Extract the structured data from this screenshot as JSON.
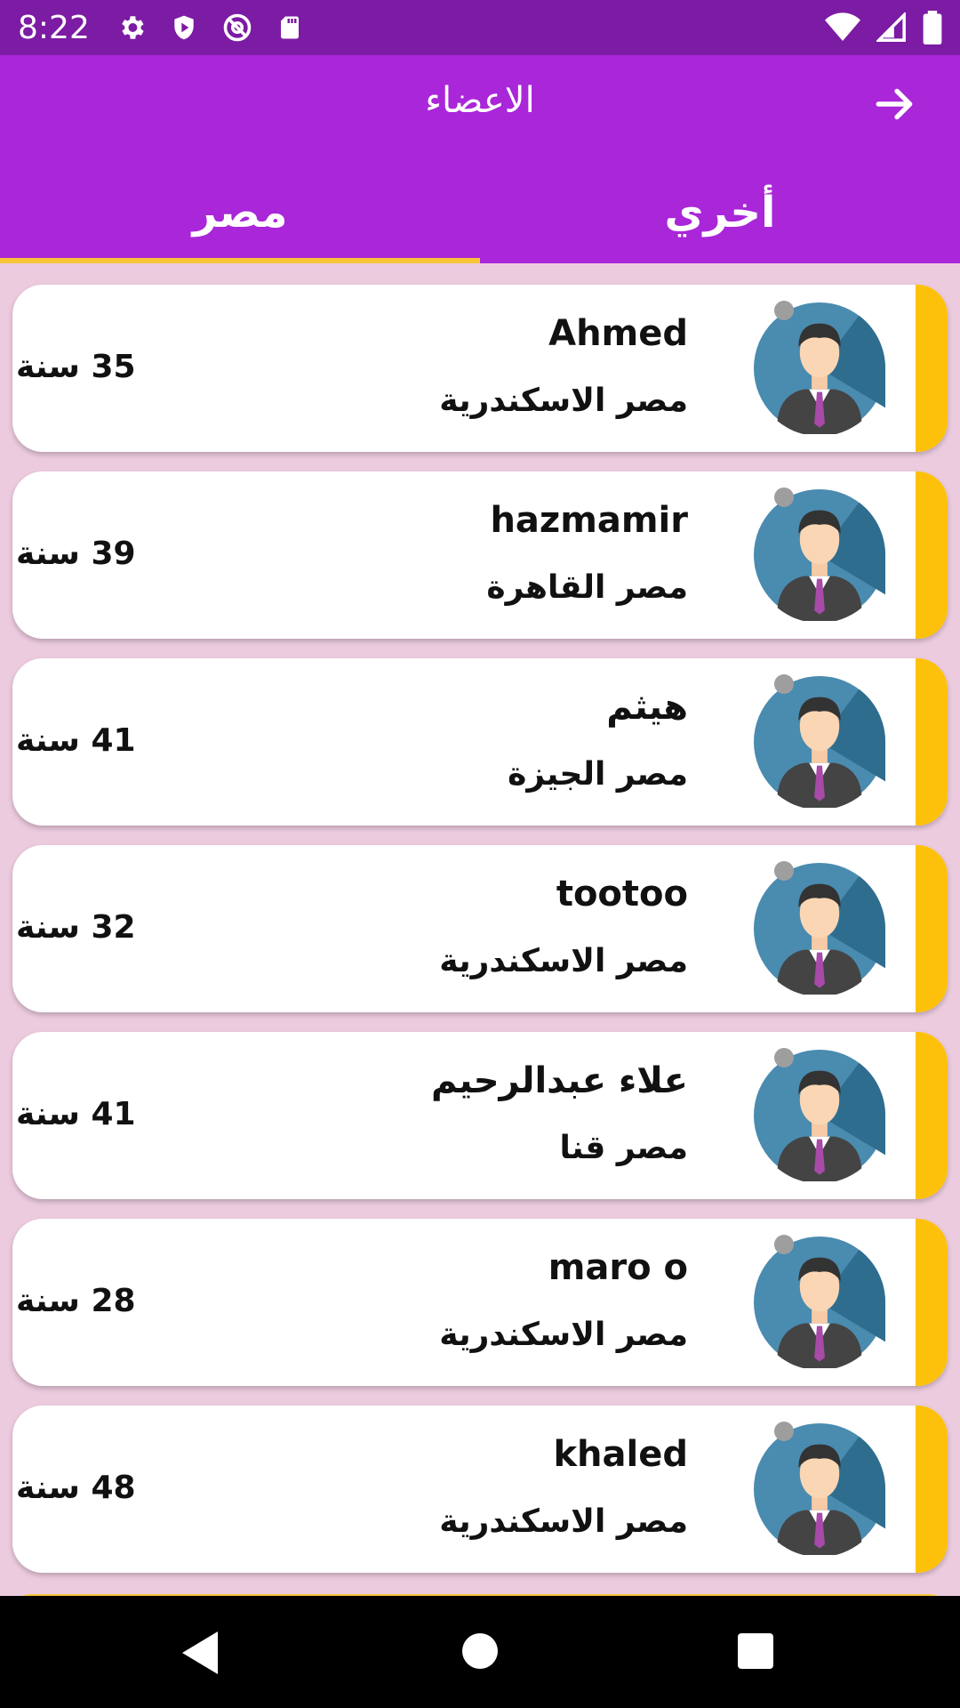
{
  "status_bar": {
    "time": "8:22",
    "left_icons": [
      "gear-icon",
      "shield-icon",
      "at-icon",
      "sd-card-icon"
    ],
    "right_icons": [
      "wifi-icon",
      "signal-icon",
      "battery-icon"
    ]
  },
  "header": {
    "title": "الاعضاء",
    "back_icon": "arrow-right-icon"
  },
  "tabs": [
    {
      "label": "مصر",
      "selected": true
    },
    {
      "label": "أخري",
      "selected": false
    }
  ],
  "colors": {
    "status_bar": "#7c1ba3",
    "app_bar": "#a926d9",
    "tab_indicator": "#f7c437",
    "card_accent": "#fdc10c",
    "background": "#eccbdf"
  },
  "members": [
    {
      "name": "Ahmed",
      "location": "مصر الاسكندرية",
      "age": "35 سنة"
    },
    {
      "name": "hazmamir",
      "location": "مصر القاهرة",
      "age": "39 سنة"
    },
    {
      "name": "هيثم",
      "location": "مصر الجيزة",
      "age": "41 سنة"
    },
    {
      "name": "tootoo",
      "location": "مصر الاسكندرية",
      "age": "32 سنة"
    },
    {
      "name": "علاء عبدالرحيم",
      "location": "مصر قنا",
      "age": "41 سنة"
    },
    {
      "name": "maro o",
      "location": "مصر الاسكندرية",
      "age": "28 سنة"
    },
    {
      "name": "khaled",
      "location": "مصر الاسكندرية",
      "age": "48 سنة"
    }
  ],
  "nav_bar": {
    "buttons": [
      "back-triangle-icon",
      "home-circle-icon",
      "recents-square-icon"
    ]
  }
}
